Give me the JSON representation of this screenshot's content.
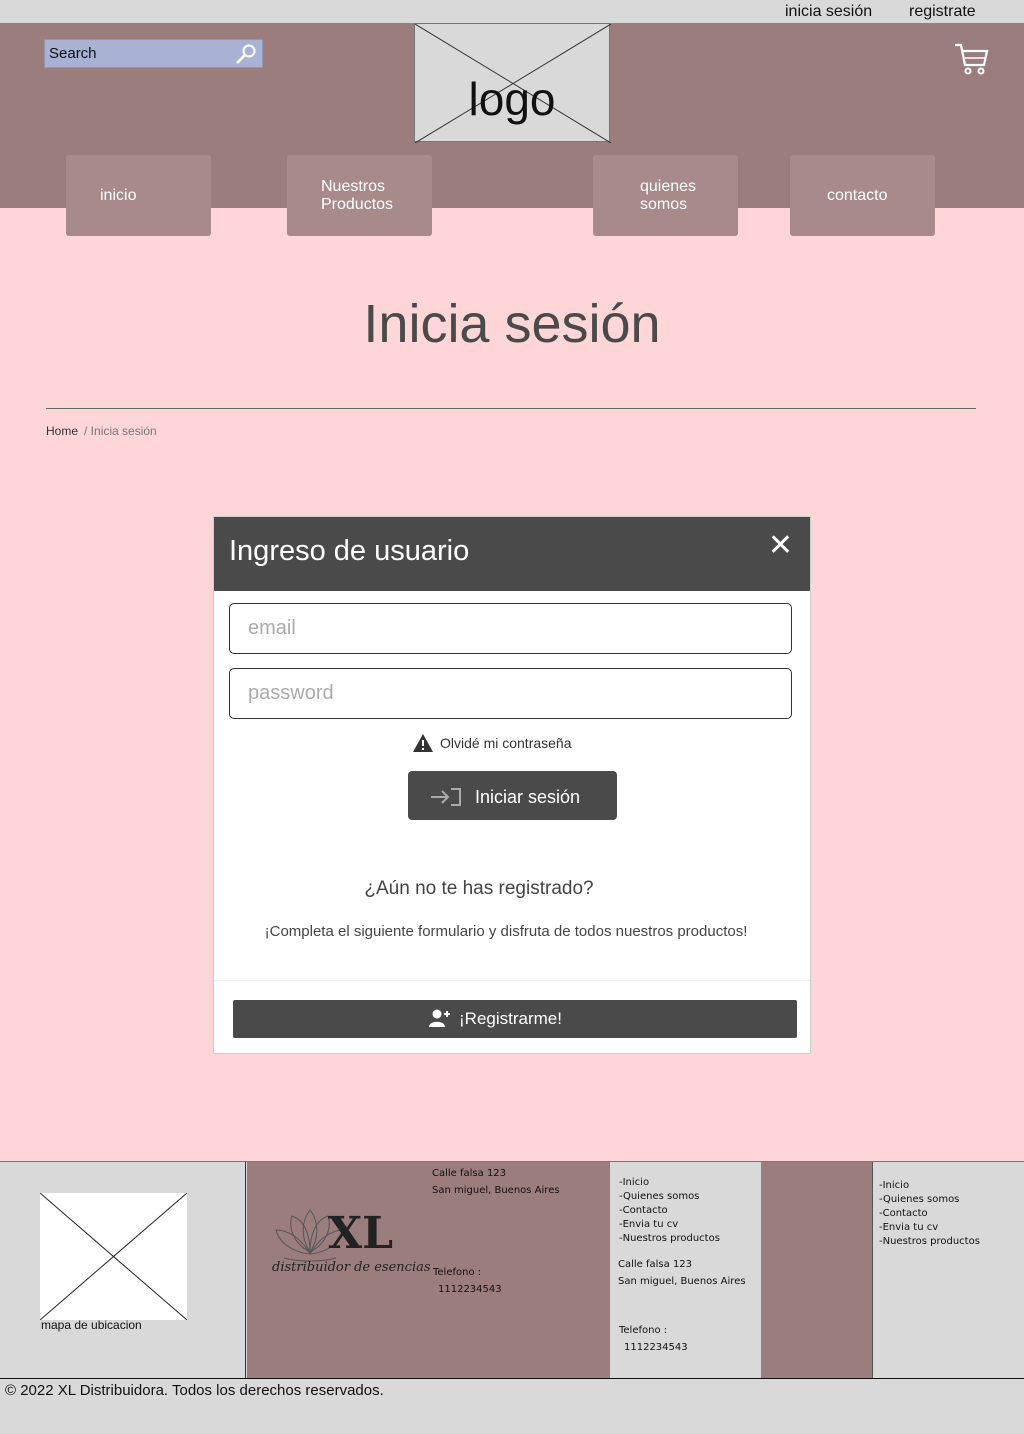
{
  "topbar": {
    "login_link": "inicia sesión",
    "register_link": "registrate"
  },
  "header": {
    "search_placeholder": "Search",
    "logo_text": "logo",
    "nav": [
      "inicio",
      "Nuestros Productos",
      "quienes somos",
      "contacto"
    ]
  },
  "page": {
    "title": "Inicia sesión",
    "breadcrumb": {
      "home": "Home",
      "current": "/ Inicia sesión"
    }
  },
  "modal": {
    "title": "Ingreso de usuario",
    "close": "✕",
    "email_placeholder": "email",
    "password_placeholder": "password",
    "forgot": "Olvidé mi contraseña",
    "login_button": "Iniciar sesión",
    "question": "¿Aún no te has registrado?",
    "description": "¡Completa el siguiente formulario y disfruta de todos nuestros productos!",
    "register_button": "¡Registrarme!"
  },
  "footer": {
    "map_label": "mapa de ubicacion",
    "brand_big": "XL",
    "brand_tagline": "distribuidor de esencias",
    "address_line1": "Calle falsa 123",
    "address_line2": "San miguel, Buenos Aires",
    "phone_label": "Telefono :",
    "phone_number": "1112234543",
    "links": [
      "-Inicio",
      "-Quienes somos",
      "-Contacto",
      "-Envia tu cv",
      "-Nuestros productos"
    ],
    "copyright": "© 2022 XL Distribuidora. Todos los derechos reservados."
  },
  "colors": {
    "page_bg": "#ffd6d7",
    "header_bg": "#9b7d7e",
    "nav_button": "#a88a8b",
    "modal_header": "#4a4a4a",
    "footer_bg": "#d9d9d9"
  }
}
